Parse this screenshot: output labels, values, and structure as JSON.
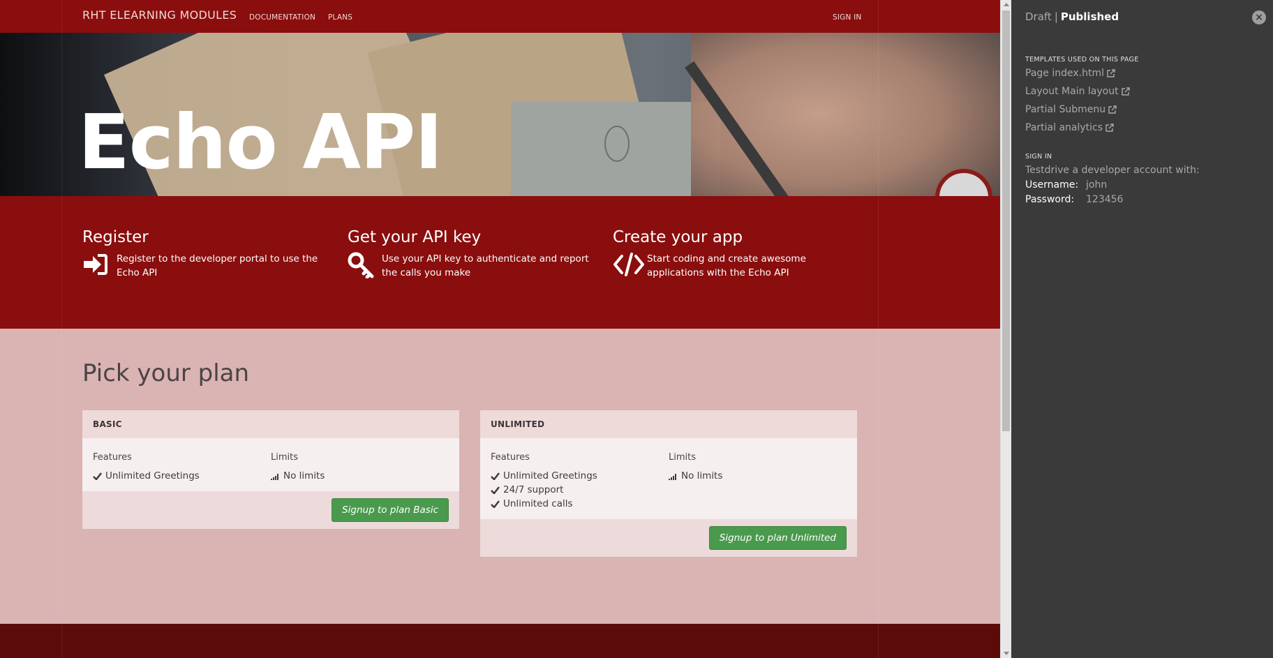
{
  "nav": {
    "brand": "RHT ELEARNING MODULES",
    "documentation": "DOCUMENTATION",
    "plans": "PLANS",
    "signin": "SIGN IN"
  },
  "hero": {
    "title": "Echo API"
  },
  "features": [
    {
      "title": "Register",
      "text": "Register to the developer portal to use the Echo API",
      "icon": "sign-in-icon"
    },
    {
      "title": "Get your API key",
      "text": "Use your API key to authenticate and report the calls you make",
      "icon": "key-icon"
    },
    {
      "title": "Create your app",
      "text": "Start coding and create awesome applications with the Echo API",
      "icon": "code-icon"
    }
  ],
  "plans": {
    "title": "Pick your plan",
    "features_label": "Features",
    "limits_label": "Limits",
    "items": [
      {
        "name": "BASIC",
        "features": [
          "Unlimited Greetings"
        ],
        "limits": [
          "No limits"
        ],
        "button": "Signup to plan Basic"
      },
      {
        "name": "UNLIMITED",
        "features": [
          "Unlimited Greetings",
          "24/7 support",
          "Unlimited calls"
        ],
        "limits": [
          "No limits"
        ],
        "button": "Signup to plan Unlimited"
      }
    ]
  },
  "panel": {
    "draft": "Draft",
    "separator": "|",
    "published": "Published",
    "templates_heading": "TEMPLATES USED ON THIS PAGE",
    "templates": [
      "Page index.html",
      "Layout Main layout",
      "Partial Submenu",
      "Partial analytics"
    ],
    "signin_heading": "SIGN IN",
    "signin_text": "Testdrive a developer account with:",
    "username_label": "Username:",
    "username_value": "john",
    "password_label": "Password:",
    "password_value": "123456"
  },
  "colors": {
    "nav_bg": "#8a0e0e",
    "plans_bg": "#dab3b3",
    "button_green": "#4a9a4d",
    "panel_bg": "#3a3a3a"
  }
}
